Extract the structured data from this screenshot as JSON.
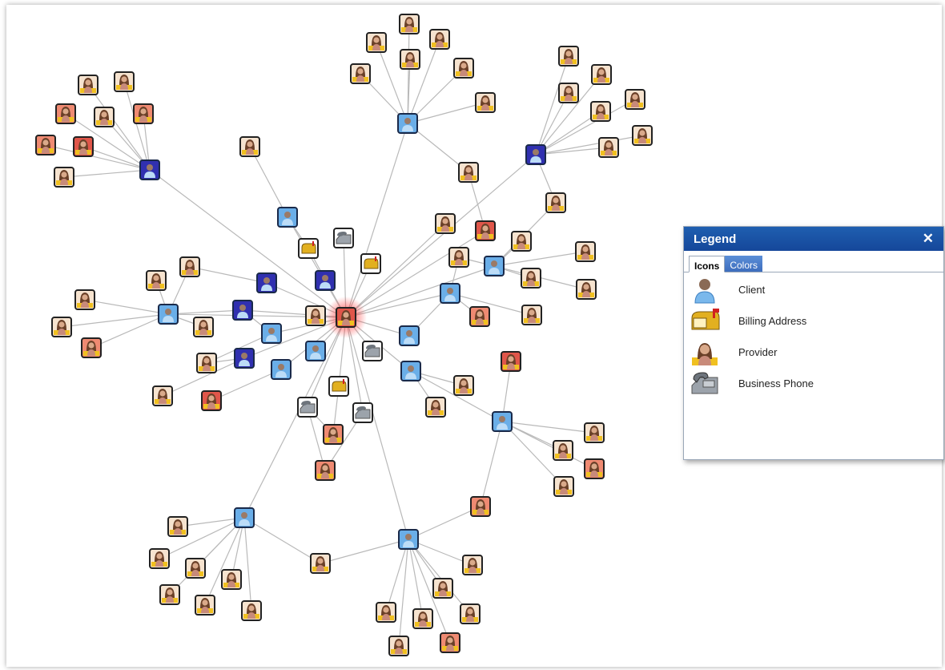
{
  "legend": {
    "title": "Legend",
    "close_glyph": "✕",
    "tabs": [
      {
        "label": "Icons",
        "active": true
      },
      {
        "label": "Colors",
        "active": false
      }
    ],
    "items": [
      {
        "label": "Client",
        "icon": "client-person-icon"
      },
      {
        "label": "Billing Address",
        "icon": "mailbox-icon"
      },
      {
        "label": "Provider",
        "icon": "provider-person-icon"
      },
      {
        "label": "Business Phone",
        "icon": "phone-icon"
      }
    ]
  },
  "colors": {
    "edge": "#b9b9b9",
    "client_light": "#6aaee8",
    "client_dark": "#3030b0",
    "provider_bg": "#f6e3cf",
    "provider_red": "#e0564a",
    "provider_salmon": "#ef8a72",
    "selected_glow": "#ff2a2a",
    "legend_header": "#1f5fb0"
  }
}
